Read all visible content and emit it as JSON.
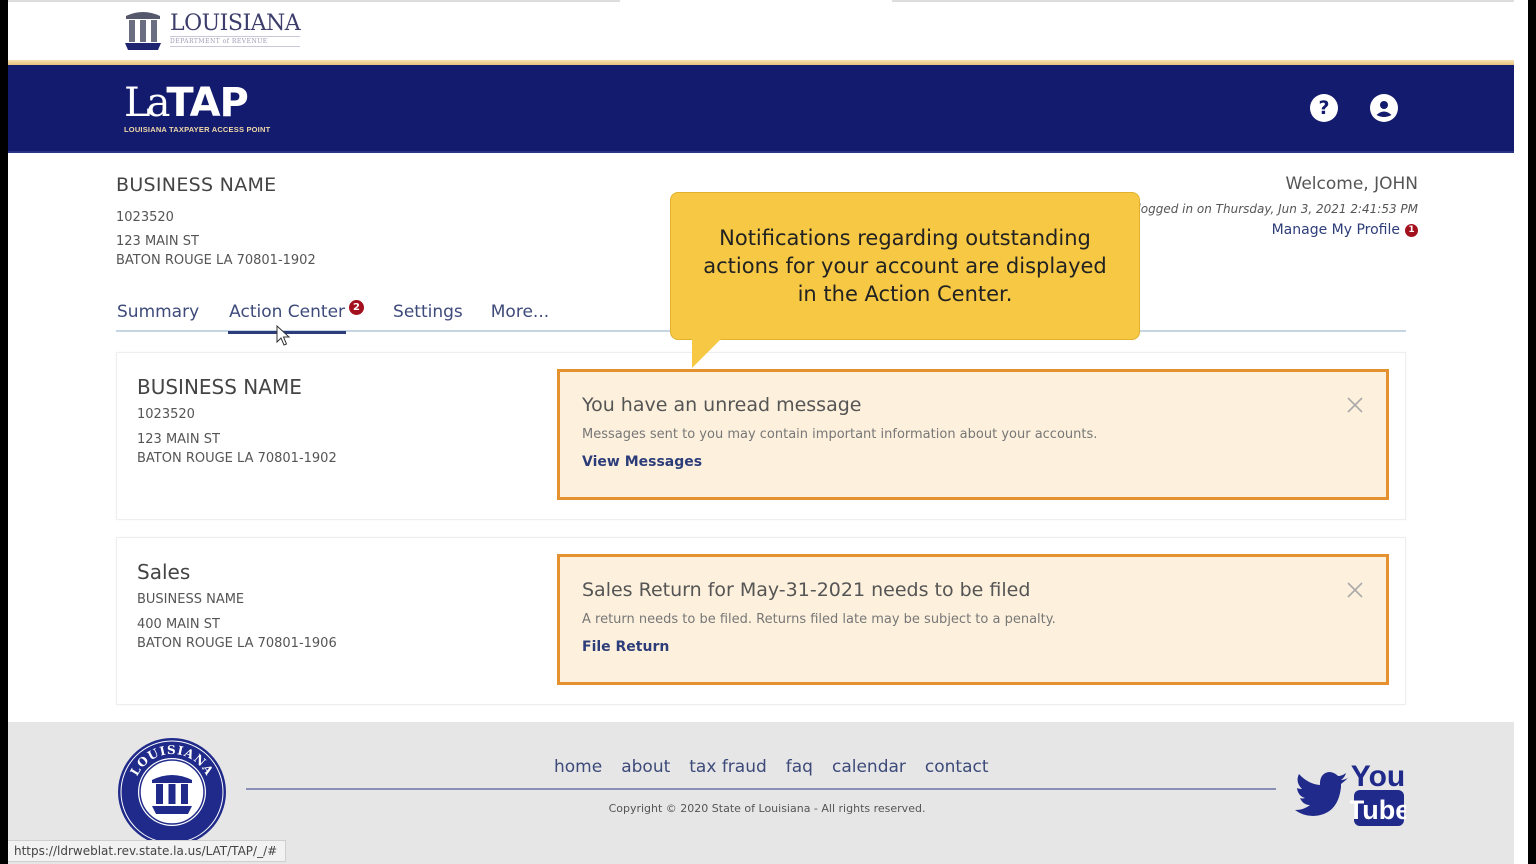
{
  "brand": {
    "dept_name": "LOUISIANA",
    "dept_sub": "DEPARTMENT of REVENUE",
    "app_la": "La",
    "app_tap": "TAP",
    "app_sub": "Louisiana Taxpayer Access Point"
  },
  "header_icons": {
    "help": "question-circle-icon",
    "user": "user-circle-icon",
    "help_glyph": "?"
  },
  "account": {
    "name": "BUSINESS NAME",
    "id": "1023520",
    "address1": "123 MAIN ST",
    "address2": "BATON ROUGE LA 70801-1902"
  },
  "user": {
    "welcome": "Welcome, JOHN",
    "last_login": "logged in on Thursday, Jun 3, 2021 2:41:53 PM",
    "manage_profile": "Manage My Profile",
    "profile_badge": "1"
  },
  "tabs": [
    {
      "label": "Summary",
      "active": false
    },
    {
      "label": "Action Center",
      "active": true,
      "badge": "2"
    },
    {
      "label": "Settings",
      "active": false
    },
    {
      "label": "More...",
      "active": false
    }
  ],
  "callout": {
    "text": "Notifications regarding outstanding actions for your account are displayed in the Action Center."
  },
  "cards": [
    {
      "title": "BUSINESS NAME",
      "line1": "1023520",
      "line2": "123 MAIN ST",
      "line3": "BATON ROUGE LA 70801-1902",
      "alert": {
        "title": "You have an unread message",
        "body": "Messages sent to you may contain important information about your accounts.",
        "link": "View Messages"
      }
    },
    {
      "title": "Sales",
      "line1": "BUSINESS NAME",
      "line2": "400 MAIN ST",
      "line3": "BATON ROUGE LA 70801-1906",
      "alert": {
        "title": "Sales Return for May-31-2021 needs to be filed",
        "body": "A return needs to be filed. Returns filed late may be subject to a penalty.",
        "link": "File Return"
      }
    }
  ],
  "footer": {
    "links": [
      "home",
      "about",
      "tax fraud",
      "faq",
      "calendar",
      "contact"
    ],
    "copyright": "Copyright © 2020 State of Louisiana - All rights reserved.",
    "seal_text": "LOUISIANA",
    "youtube_you": "You",
    "youtube_tube": "Tube"
  },
  "status_bar": {
    "url": "https://ldrweblat.rev.state.la.us/LAT/TAP/_/#"
  },
  "colors": {
    "navy": "#131b6e",
    "gold": "#e7c27a",
    "alert_border": "#e69130",
    "alert_bg": "#fdf1dd",
    "callout": "#f7c843",
    "badge": "#a3101e",
    "link": "#2d3d7a"
  }
}
